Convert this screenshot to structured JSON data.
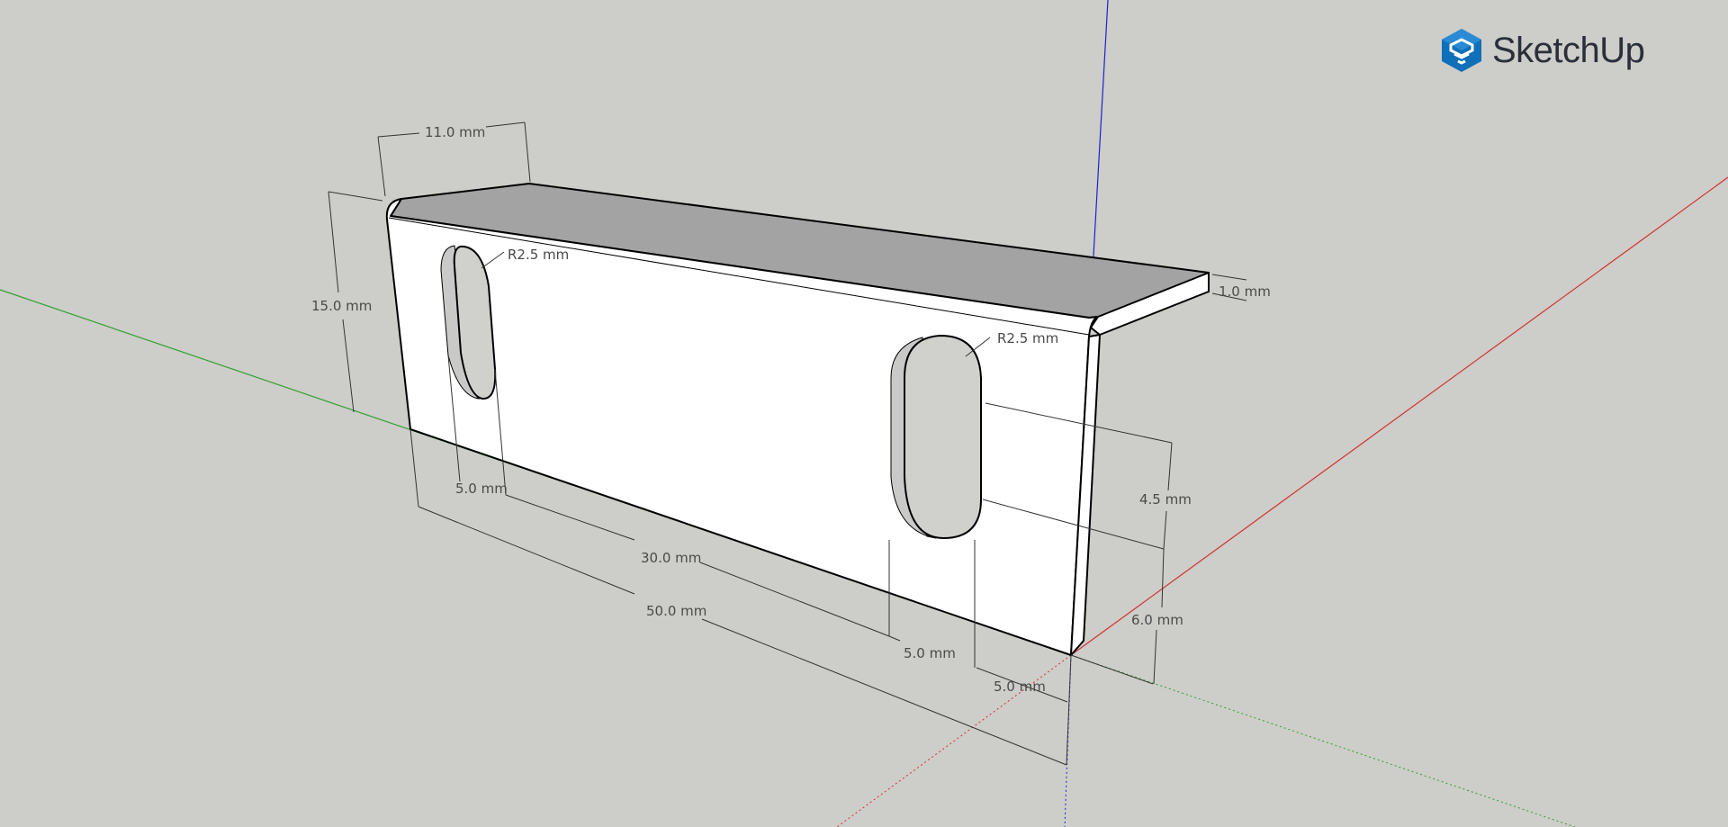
{
  "app": {
    "brand": "SketchUp",
    "logo_icon": "sketchup-cube-icon",
    "brand_color": "#0f6fb8"
  },
  "colors": {
    "background": "#cdcdc9",
    "face": "#ffffff",
    "top_face": "#a3a3a3",
    "inner_face": "#c9c9c7",
    "axis_red": "#d43030",
    "axis_green": "#30a030",
    "axis_blue": "#2020d0"
  },
  "dimensions": {
    "flange_depth": "11.0 mm",
    "height": "15.0 mm",
    "slot_radius_left": "R2.5 mm",
    "slot_radius_right": "R2.5 mm",
    "thickness": "1.0 mm",
    "slot_width_left": "5.0 mm",
    "slot_spacing": "30.0 mm",
    "overall_length": "50.0 mm",
    "slot_width_right": "5.0 mm",
    "edge_offset": "5.0 mm",
    "slot_length": "4.5 mm",
    "slot_bottom_offset": "6.0 mm"
  }
}
